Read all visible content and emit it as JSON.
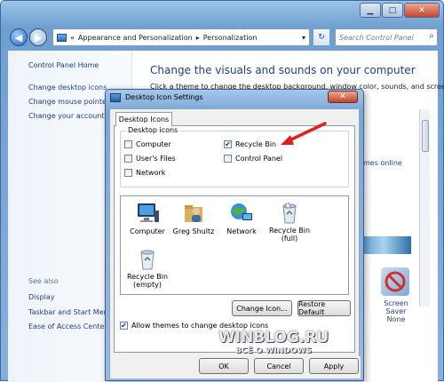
{
  "window": {
    "minimize": "▁",
    "maximize": "□",
    "close": "✕"
  },
  "nav": {
    "back": "◀",
    "forward": "▶",
    "breadcrumb": [
      "«",
      "Appearance and Personalization",
      "▸",
      "Personalization"
    ],
    "dropdown": "▾",
    "refresh": "↻",
    "search_placeholder": "Search Control Panel"
  },
  "left_pane": {
    "home": "Control Panel Home",
    "links": [
      "Change desktop icons",
      "Change mouse pointers",
      "Change your account picture"
    ],
    "see_also": "See also",
    "see_also_links": [
      "Display",
      "Taskbar and Start Menu",
      "Ease of Access Center"
    ]
  },
  "main": {
    "heading": "Change the visuals and sounds on your computer",
    "subtext": "Click a theme to change the desktop background, window color, sounds, and screen",
    "themes_link": "hemes online",
    "screen_saver_label": "Screen Saver",
    "screen_saver_value": "None"
  },
  "dialog": {
    "title": "Desktop Icon Settings",
    "close": "✕",
    "tab": "Desktop Icons",
    "group_label": "Desktop icons",
    "checkboxes": [
      {
        "label": "Computer",
        "checked": false
      },
      {
        "label": "Recycle Bin",
        "checked": true
      },
      {
        "label": "User's Files",
        "checked": false
      },
      {
        "label": "Control Panel",
        "checked": false
      },
      {
        "label": "Network",
        "checked": false
      }
    ],
    "icons": [
      {
        "label": "Computer",
        "icon": "computer-icon"
      },
      {
        "label": "Greg Shultz",
        "icon": "user-folder-icon"
      },
      {
        "label": "Network",
        "icon": "network-icon"
      },
      {
        "label": "Recycle Bin\n(full)",
        "icon": "recycle-bin-full-icon"
      },
      {
        "label": "Recycle Bin\n(empty)",
        "icon": "recycle-bin-empty-icon"
      }
    ],
    "change_icon": "Change Icon...",
    "restore_default": "Restore Default",
    "allow_themes": "Allow themes to change desktop icons",
    "allow_themes_checked": true,
    "ok": "OK",
    "cancel": "Cancel",
    "apply": "Apply"
  },
  "watermark": {
    "line1": "WINBLOG.RU",
    "line2": "ВСЁ О WINDOWS"
  },
  "colors": {
    "link": "#1e3e8f",
    "arrow": "#d9241b"
  }
}
